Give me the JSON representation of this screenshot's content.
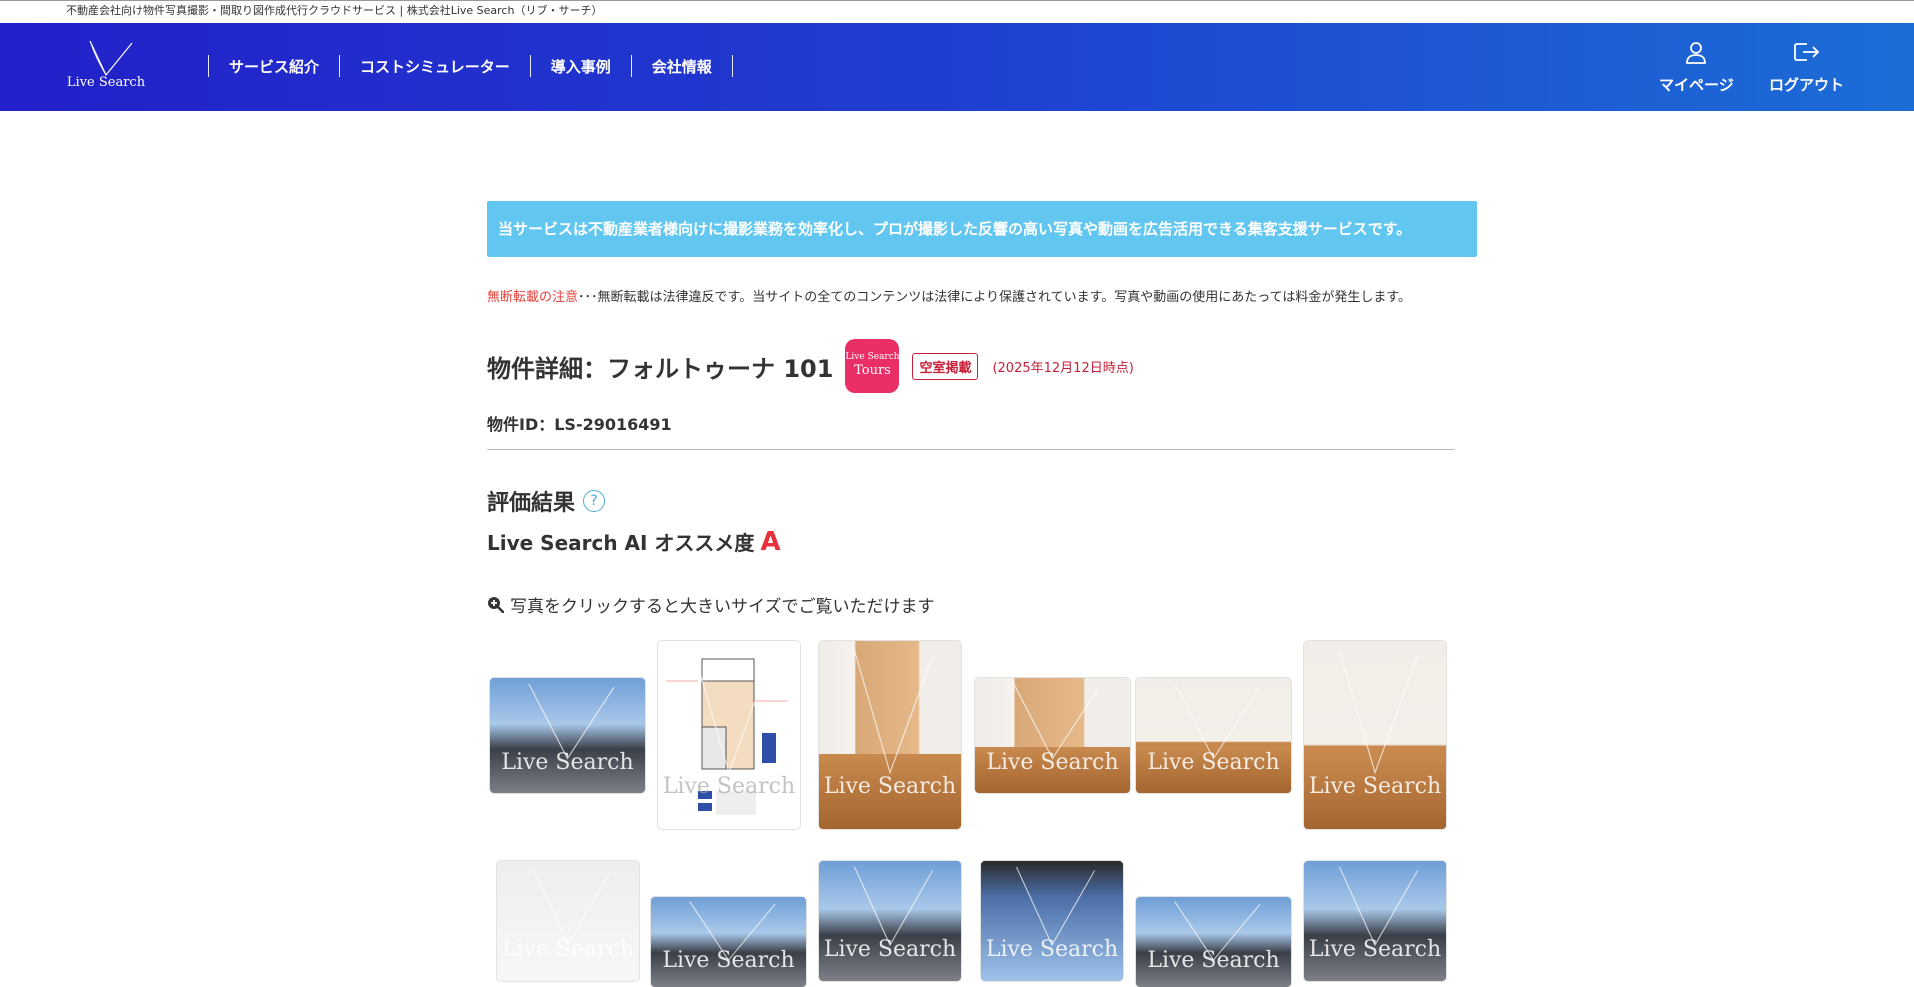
{
  "topbar": {
    "text": "不動産会社向け物件写真撮影・間取り図作成代行クラウドサービス | 株式会社Live Search（リブ・サーチ）"
  },
  "header": {
    "logo_text": "Live Search",
    "nav": [
      "サービス紹介",
      "コストシミュレーター",
      "導入事例",
      "会社情報"
    ],
    "mypage_label": "マイページ",
    "logout_label": "ログアウト"
  },
  "banner": {
    "text": "当サービスは不動産業者様向けに撮影業務を効率化し、プロが撮影した反響の高い写真や動画を広告活用できる集客支援サービスです。"
  },
  "notice": {
    "warn": "無断転載の注意",
    "text": "･･･無断転載は法律違反です。当サイトの全てのコンテンツは法律により保護されています。写真や動画の使用にあたっては料金が発生します。"
  },
  "property": {
    "title": "物件詳細：フォルトゥーナ 101",
    "tours_line1": "Live Search",
    "tours_line2": "Tours",
    "vacant_badge": "空室掲載",
    "as_of": "(2025年12月12日時点)",
    "id_text": "物件ID：LS-29016491"
  },
  "evaluation": {
    "title": "評価結果",
    "help": "?",
    "ai_label": "Live Search AI オススメ度",
    "ai_grade": "A"
  },
  "gallery": {
    "hint": "写真をクリックすると大きいサイズでご覧いただけます",
    "watermark": "Live Search",
    "photos": [
      {
        "name": "exterior-photo",
        "kind": "exterior"
      },
      {
        "name": "floorplan-photo",
        "kind": "floorplan"
      },
      {
        "name": "room-closet-photo",
        "kind": "closet"
      },
      {
        "name": "room-wide-photo",
        "kind": "closet"
      },
      {
        "name": "room-window-photo",
        "kind": "window"
      },
      {
        "name": "room-window-tall-photo",
        "kind": "window"
      },
      {
        "name": "photo-7",
        "kind": "light"
      },
      {
        "name": "photo-8",
        "kind": "exterior"
      },
      {
        "name": "photo-9",
        "kind": "exterior"
      },
      {
        "name": "photo-10",
        "kind": "dark"
      },
      {
        "name": "photo-11",
        "kind": "exterior"
      },
      {
        "name": "photo-12",
        "kind": "exterior"
      }
    ]
  },
  "colors": {
    "header_start": "#2320c9",
    "header_end": "#1c6dd6",
    "banner": "#62c7f0",
    "accent_red": "#e8303a",
    "tours_pink": "#ea2f67"
  }
}
